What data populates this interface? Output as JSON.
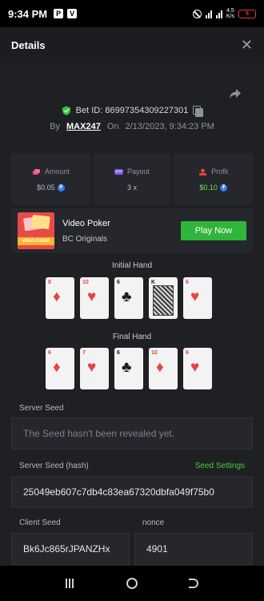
{
  "status_bar": {
    "time": "9:34 PM",
    "net_speed": "4.5\nK/s",
    "battery": "5"
  },
  "header": {
    "title": "Details"
  },
  "bet": {
    "id_label": "Bet ID: 86997354309227301",
    "by_label": "By",
    "user": "MAX247",
    "on_label": "On",
    "date": "2/13/2023, 9:34:23 PM"
  },
  "stats": {
    "amount_label": "Amount",
    "amount_value": "$0.05",
    "payout_label": "Payout",
    "payout_value": "3 x",
    "profit_label": "Profit",
    "profit_value": "$0.10"
  },
  "game": {
    "thumb_text": "VIDEO POKER",
    "name": "Video Poker",
    "provider": "BC Originals",
    "play_label": "Play Now"
  },
  "initial_hand": {
    "title": "Initial Hand",
    "cards": [
      {
        "rank": "8",
        "suit": "♦",
        "color": "#e8433f"
      },
      {
        "rank": "10",
        "suit": "♥",
        "color": "#e8433f"
      },
      {
        "rank": "6",
        "suit": "♣",
        "color": "#1d1d1f"
      },
      {
        "rank": "K",
        "suit": "♣",
        "color": "#1d1d1f"
      },
      {
        "rank": "6",
        "suit": "♥",
        "color": "#e8433f"
      }
    ]
  },
  "final_hand": {
    "title": "Final Hand",
    "cards": [
      {
        "rank": "6",
        "suit": "♦",
        "color": "#e8433f"
      },
      {
        "rank": "7",
        "suit": "♥",
        "color": "#e8433f"
      },
      {
        "rank": "6",
        "suit": "♣",
        "color": "#1d1d1f"
      },
      {
        "rank": "10",
        "suit": "♦",
        "color": "#e8433f"
      },
      {
        "rank": "6",
        "suit": "♥",
        "color": "#e8433f"
      }
    ]
  },
  "seeds": {
    "server_seed_label": "Server Seed",
    "server_seed_value": "The Seed hasn't been revealed yet.",
    "server_hash_label": "Server Seed (hash)",
    "seed_settings_label": "Seed Settings",
    "server_hash_value": "25049eb607c7db4c83ea67320dbfa049f75b0",
    "client_seed_label": "Client Seed",
    "client_seed_value": "Bk6Jc865rJPANZHx",
    "nonce_label": "nonce",
    "nonce_value": "4901"
  },
  "colors": {
    "accent_green": "#2fb53a",
    "profit_green": "#6fe248",
    "red_suit": "#e8433f"
  }
}
